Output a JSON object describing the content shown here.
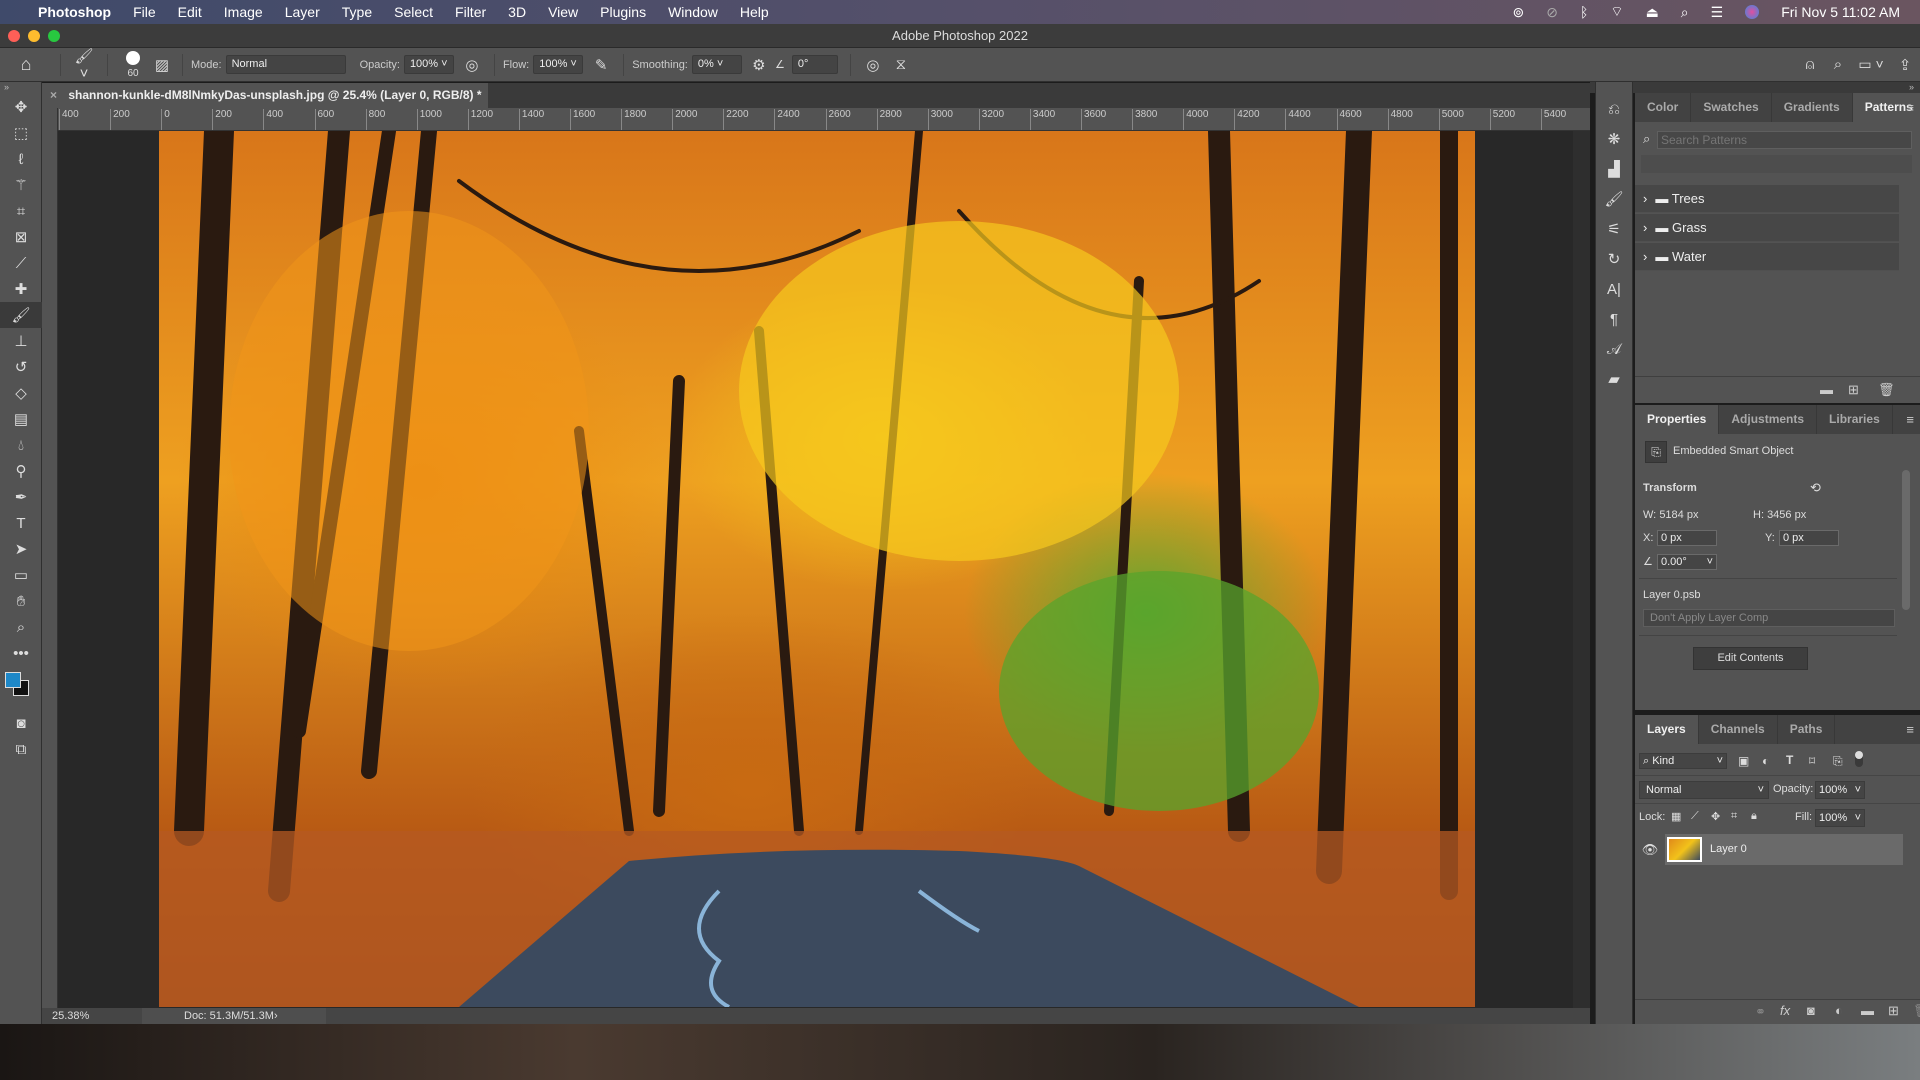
{
  "menubar": {
    "app": "Photoshop",
    "items": [
      "File",
      "Edit",
      "Image",
      "Layer",
      "Type",
      "Select",
      "Filter",
      "3D",
      "View",
      "Plugins",
      "Window",
      "Help"
    ],
    "datetime": "Fri Nov 5  11:02 AM"
  },
  "window": {
    "title": "Adobe Photoshop 2022"
  },
  "options": {
    "brush_size": "60",
    "mode_label": "Mode:",
    "mode_value": "Normal",
    "opacity_label": "Opacity:",
    "opacity_value": "100%",
    "flow_label": "Flow:",
    "flow_value": "100%",
    "smoothing_label": "Smoothing:",
    "smoothing_value": "0%",
    "angle_value": "0°"
  },
  "document": {
    "tab_title": "shannon-kunkle-dM8lNmkyDas-unsplash.jpg @ 25.4% (Layer 0, RGB/8) *",
    "zoom": "25.38%",
    "doc_info": "Doc: 51.3M/51.3M"
  },
  "ruler": {
    "h_ticks": [
      "400",
      "200",
      "0",
      "200",
      "400",
      "600",
      "800",
      "1000",
      "1200",
      "1400",
      "1600",
      "1800",
      "2000",
      "2200",
      "2400",
      "2600",
      "2800",
      "3000",
      "3200",
      "3400",
      "3600",
      "3800",
      "4000",
      "4200",
      "4400",
      "4600",
      "4800",
      "5000",
      "5200",
      "5400"
    ]
  },
  "colors": {
    "foreground": "#1e88c8",
    "background": "#111111",
    "accent": "#535353"
  },
  "patterns_panel": {
    "tabs": [
      "Color",
      "Swatches",
      "Gradients",
      "Patterns"
    ],
    "active_tab": "Patterns",
    "search_placeholder": "Search Patterns",
    "groups": [
      "Trees",
      "Grass",
      "Water"
    ]
  },
  "properties_panel": {
    "tabs": [
      "Properties",
      "Adjustments",
      "Libraries"
    ],
    "object_type": "Embedded Smart Object",
    "transform_label": "Transform",
    "w_label": "W:",
    "w_value": "5184 px",
    "h_label": "H:",
    "h_value": "3456 px",
    "x_label": "X:",
    "x_value": "0 px",
    "y_label": "Y:",
    "y_value": "0 px",
    "angle_value": "0.00°",
    "file_name": "Layer 0.psb",
    "layer_comp": "Don't Apply Layer Comp",
    "edit_button": "Edit Contents"
  },
  "layers_panel": {
    "tabs": [
      "Layers",
      "Channels",
      "Paths"
    ],
    "filter_kind": "Kind",
    "blend_mode": "Normal",
    "opacity_label": "Opacity:",
    "opacity_value": "100%",
    "lock_label": "Lock:",
    "fill_label": "Fill:",
    "fill_value": "100%",
    "layers": [
      {
        "name": "Layer 0",
        "visible": true
      }
    ]
  }
}
